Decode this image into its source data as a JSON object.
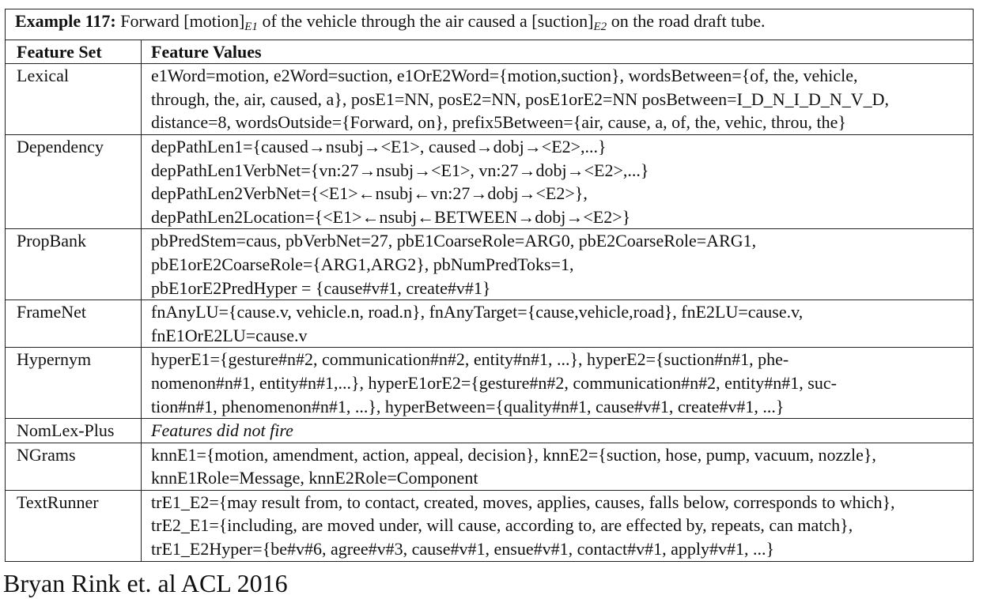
{
  "caption": {
    "label": "Example 117:",
    "text_parts": [
      " Forward [motion]",
      "E1",
      " of the vehicle through the air caused a [suction]",
      "E2",
      " on the road draft tube."
    ]
  },
  "table": {
    "headers": [
      "Feature Set",
      "Feature Values"
    ],
    "rows": [
      {
        "feature": "Lexical",
        "lines": [
          "e1Word=motion, e2Word=suction, e1OrE2Word={motion,suction}, wordsBetween={of, the, vehicle,",
          "through, the, air, caused, a}, posE1=NN, posE2=NN, posE1orE2=NN posBetween=I_D_N_I_D_N_V_D,",
          "distance=8, wordsOutside={Forward, on}, prefix5Between={air, cause, a, of, the, vehic, throu, the}"
        ]
      },
      {
        "feature": "Dependency",
        "lines": [
          "depPathLen1={caused→nsubj→<E1>, caused→dobj→<E2>,...}",
          "depPathLen1VerbNet={vn:27→nsubj→<E1>, vn:27→dobj→<E2>,...}",
          "depPathLen2VerbNet={<E1>←nsubj←vn:27→dobj→<E2>},",
          "depPathLen2Location={<E1>←nsubj←BETWEEN→dobj→<E2>}"
        ]
      },
      {
        "feature": "PropBank",
        "lines": [
          "pbPredStem=caus, pbVerbNet=27, pbE1CoarseRole=ARG0, pbE2CoarseRole=ARG1,",
          "pbE1orE2CoarseRole={ARG1,ARG2}, pbNumPredToks=1,",
          "pbE1orE2PredHyper = {cause#v#1, create#v#1}"
        ]
      },
      {
        "feature": "FrameNet",
        "lines": [
          "fnAnyLU={cause.v,    vehicle.n,    road.n},    fnAnyTarget={cause,vehicle,road},    fnE2LU=cause.v,",
          "fnE1OrE2LU=cause.v"
        ]
      },
      {
        "feature": "Hypernym",
        "lines": [
          "hyperE1={gesture#n#2,   communication#n#2,   entity#n#1,   ...},   hyperE2={suction#n#1,   phe-",
          "nomenon#n#1, entity#n#1,...}, hyperE1orE2={gesture#n#2, communication#n#2, entity#n#1, suc-",
          "tion#n#1, phenomenon#n#1, ...}, hyperBetween={quality#n#1, cause#v#1, create#v#1, ...}"
        ]
      },
      {
        "feature": "NomLex-Plus",
        "italic": true,
        "lines": [
          "Features did not fire"
        ]
      },
      {
        "feature": "NGrams",
        "lines": [
          "knnE1={motion, amendment, action, appeal, decision}, knnE2={suction, hose, pump, vacuum, nozzle},",
          "knnE1Role=Message, knnE2Role=Component"
        ]
      },
      {
        "feature": "TextRunner",
        "lines": [
          "trE1_E2={may result from, to contact, created, moves, applies, causes, falls below, corresponds to which},",
          "trE2_E1={including, are moved under, will cause, according to, are effected by, repeats, can match},",
          "trE1_E2Hyper={be#v#6, agree#v#3, cause#v#1, ensue#v#1, contact#v#1, apply#v#1, ...}"
        ]
      }
    ]
  },
  "footer": "Bryan Rink et. al ACL 2016"
}
